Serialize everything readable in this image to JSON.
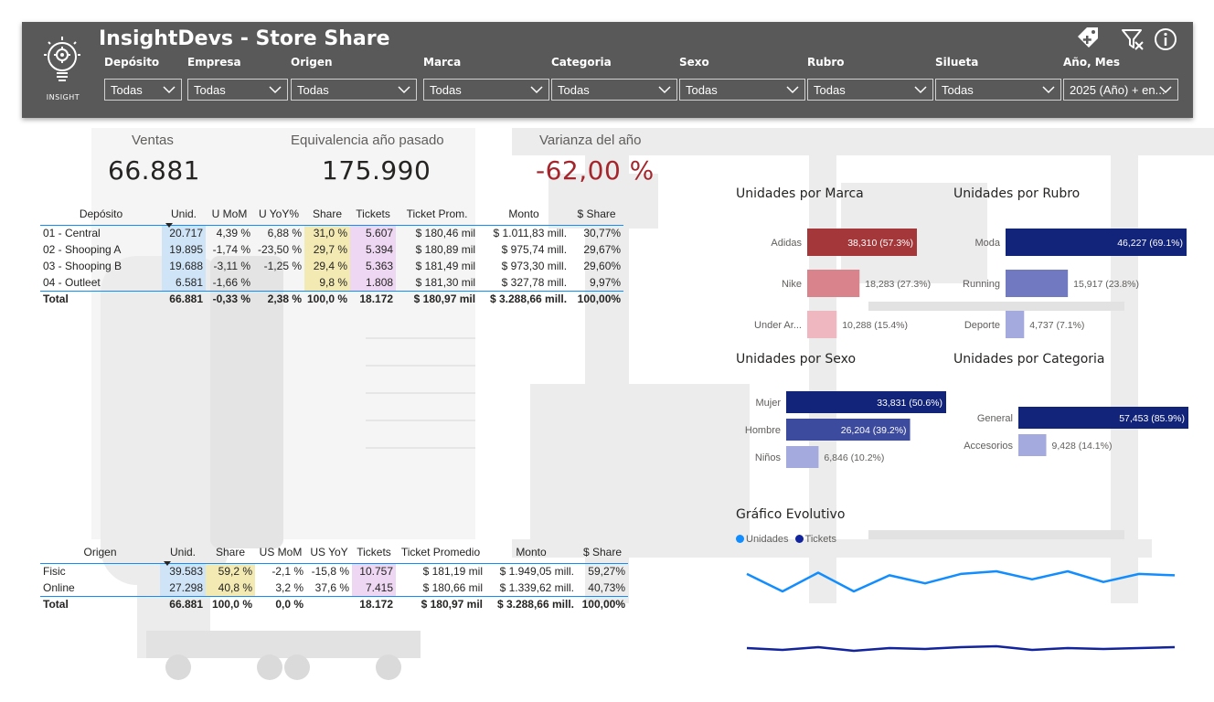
{
  "header": {
    "title": "InsightDevs - Store Share",
    "logo_text": "INSIGHT",
    "background": "#595959",
    "icons": [
      "tag-plus-icon",
      "clear-filter-icon",
      "info-icon"
    ],
    "filters": [
      {
        "label": "Depósito",
        "value": "Todas"
      },
      {
        "label": "Empresa",
        "value": "Todas"
      },
      {
        "label": "Origen",
        "value": "Todas"
      },
      {
        "label": "Marca",
        "value": "Todas"
      },
      {
        "label": "Categoria",
        "value": "Todas"
      },
      {
        "label": "Sexo",
        "value": "Todas"
      },
      {
        "label": "Rubro",
        "value": "Todas"
      },
      {
        "label": "Silueta",
        "value": "Todas"
      },
      {
        "label": "Año, Mes",
        "value": "2025 (Año) + en..."
      }
    ]
  },
  "kpis": [
    {
      "label": "Ventas",
      "value": "66.881"
    },
    {
      "label": "Equivalencia año pasado",
      "value": "175.990"
    },
    {
      "label": "Varianza del año",
      "value": "-62,00 %"
    }
  ],
  "deposito_table": {
    "columns": [
      "Depósito",
      "Unid.",
      "U MoM",
      "U YoY%",
      "Share",
      "Tickets",
      "Ticket Prom.",
      "Monto",
      "$ Share"
    ],
    "rows": [
      [
        "01 - Central",
        "20.717",
        "4,39 %",
        "6,88 %",
        "31,0 %",
        "5.607",
        "$ 180,46 mil",
        "$ 1.011,83 mill.",
        "30,77%"
      ],
      [
        "02 - Shooping A",
        "19.895",
        "-1,74 %",
        "-23,50 %",
        "29,7 %",
        "5.394",
        "$ 180,89 mil",
        "$ 975,74 mill.",
        "29,67%"
      ],
      [
        "03 - Shooping B",
        "19.688",
        "-3,11 %",
        "-1,25 %",
        "29,4 %",
        "5.363",
        "$ 181,49 mil",
        "$ 973,30 mill.",
        "29,60%"
      ],
      [
        "04 - Outleet",
        "6.581",
        "-1,66 %",
        "",
        "9,8 %",
        "1.808",
        "$ 181,30 mil",
        "$ 327,78 mill.",
        "9,97%"
      ]
    ],
    "total": [
      "Total",
      "66.881",
      "-0,33 %",
      "2,38 %",
      "100,0 %",
      "18.172",
      "$ 180,97 mil",
      "$ 3.288,66 mill.",
      "100,00%"
    ]
  },
  "origen_table": {
    "columns": [
      "Origen",
      "Unid.",
      "Share",
      "US MoM",
      "US YoY",
      "Tickets",
      "Ticket Promedio",
      "Monto",
      "$ Share"
    ],
    "rows": [
      [
        "Fisic",
        "39.583",
        "59,2 %",
        "-2,1 %",
        "-15,8 %",
        "10.757",
        "$ 181,19 mil",
        "$ 1.949,05 mill.",
        "59,27%"
      ],
      [
        "Online",
        "27.298",
        "40,8 %",
        "3,2 %",
        "37,6 %",
        "7.415",
        "$ 180,66 mil",
        "$ 1.339,62 mill.",
        "40,73%"
      ]
    ],
    "total": [
      "Total",
      "66.881",
      "100,0 %",
      "0,0 %",
      "",
      "18.172",
      "$ 180,97 mil",
      "$ 3.288,66 mill.",
      "100,00%"
    ]
  },
  "chart_data": [
    {
      "type": "bar",
      "title": "Unidades por Marca",
      "categories": [
        "Adidas",
        "Nike",
        "Under Ar..."
      ],
      "values": [
        38310,
        18283,
        10288
      ],
      "labels": [
        "38,310 (57.3%)",
        "18,283 (27.3%)",
        "10,288 (15.4%)"
      ],
      "colors": [
        "#a4373a",
        "#d9838c",
        "#efb8c0"
      ]
    },
    {
      "type": "bar",
      "title": "Unidades por Rubro",
      "categories": [
        "Moda",
        "Running",
        "Deporte"
      ],
      "values": [
        46227,
        15917,
        4737
      ],
      "labels": [
        "46,227 (69.1%)",
        "15,917 (23.8%)",
        "4,737 (7.1%)"
      ],
      "colors": [
        "#12237a",
        "#7179c0",
        "#a4aadd"
      ]
    },
    {
      "type": "bar",
      "title": "Unidades por Sexo",
      "categories": [
        "Mujer",
        "Hombre",
        "Niños"
      ],
      "values": [
        33831,
        26204,
        6846
      ],
      "labels": [
        "33,831 (50.6%)",
        "26,204 (39.2%)",
        "6,846 (10.2%)"
      ],
      "colors": [
        "#12237a",
        "#3d4b9e",
        "#a4aadd"
      ]
    },
    {
      "type": "bar",
      "title": "Unidades por Categoria",
      "categories": [
        "General",
        "Accesorios"
      ],
      "values": [
        57453,
        9428
      ],
      "labels": [
        "57,453 (85.9%)",
        "9,428 (14.1%)"
      ],
      "colors": [
        "#12237a",
        "#a4aadd"
      ]
    },
    {
      "type": "line",
      "title": "Gráfico Evolutivo",
      "series": [
        {
          "name": "Unidades",
          "color": "#118dff",
          "values": [
            5900,
            5250,
            5950,
            5250,
            5850,
            5550,
            5900,
            6000,
            5700,
            6000,
            5600,
            5900,
            5850
          ]
        },
        {
          "name": "Tickets",
          "color": "#12239e",
          "values": [
            1600,
            1590,
            1605,
            1585,
            1600,
            1595,
            1605,
            1610,
            1590,
            1600,
            1595,
            1600,
            1605
          ]
        }
      ]
    }
  ]
}
